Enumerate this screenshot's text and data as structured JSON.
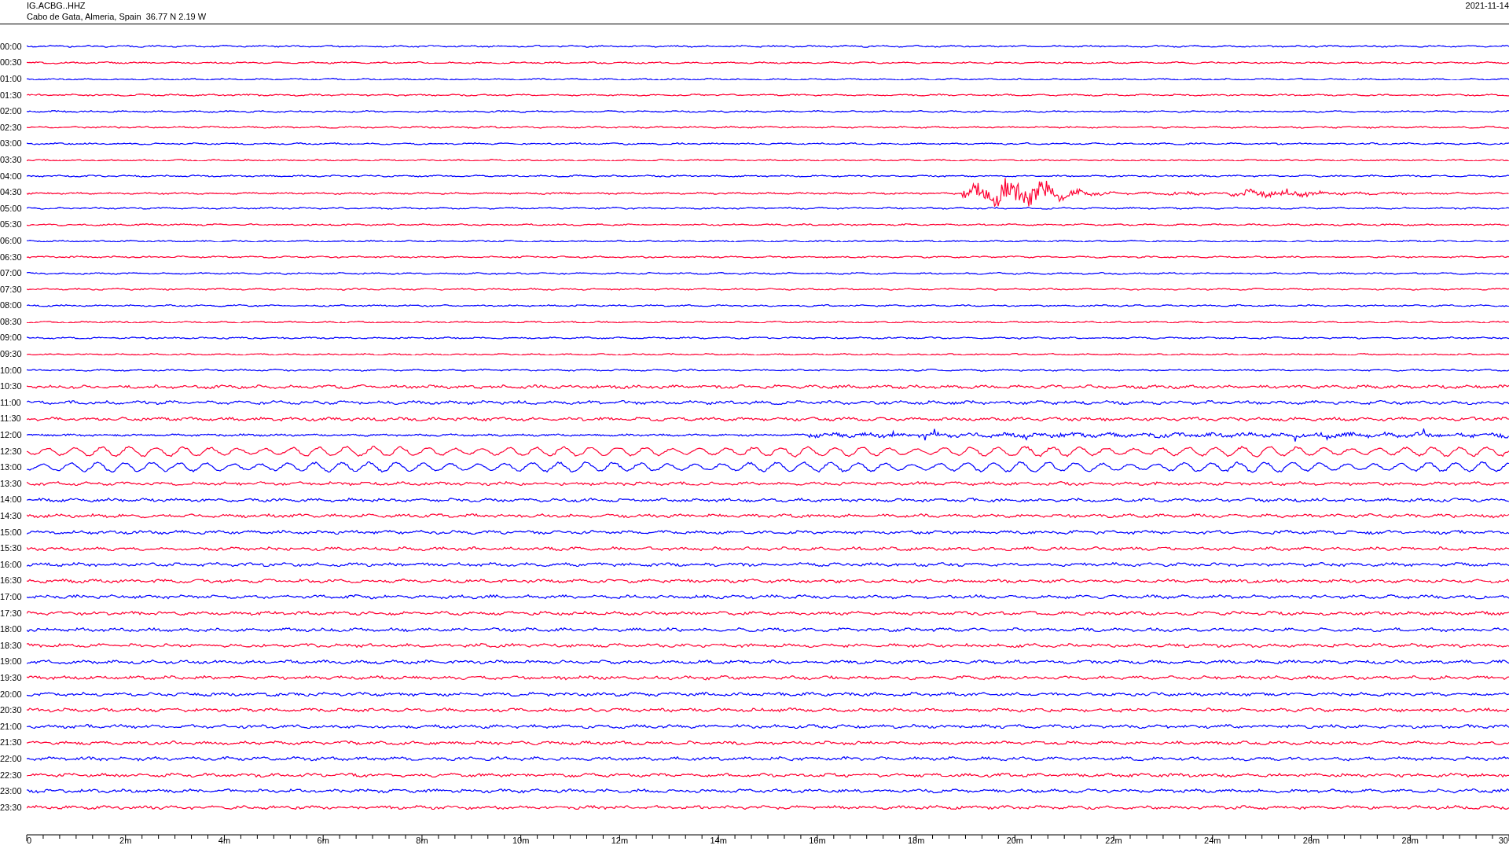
{
  "header": {
    "station": "IG.ACBG..HHZ",
    "location": "Cabo de Gata, Almeria, Spain  36.77 N 2.19 W",
    "date": "2021-11-14"
  },
  "traces": [
    {
      "time": "00:00",
      "color": "#0000ff",
      "kind": "quiet"
    },
    {
      "time": "00:30",
      "color": "#ff0033",
      "kind": "quiet"
    },
    {
      "time": "01:00",
      "color": "#0000ff",
      "kind": "quiet"
    },
    {
      "time": "01:30",
      "color": "#ff0033",
      "kind": "quiet"
    },
    {
      "time": "02:00",
      "color": "#0000ff",
      "kind": "quiet"
    },
    {
      "time": "02:30",
      "color": "#ff0033",
      "kind": "quiet"
    },
    {
      "time": "03:00",
      "color": "#0000ff",
      "kind": "quiet"
    },
    {
      "time": "03:30",
      "color": "#ff0033",
      "kind": "quiet"
    },
    {
      "time": "04:00",
      "color": "#0000ff",
      "kind": "quiet"
    },
    {
      "time": "04:30",
      "color": "#ff0033",
      "kind": "event"
    },
    {
      "time": "05:00",
      "color": "#0000ff",
      "kind": "quiet"
    },
    {
      "time": "05:30",
      "color": "#ff0033",
      "kind": "quiet"
    },
    {
      "time": "06:00",
      "color": "#0000ff",
      "kind": "quiet"
    },
    {
      "time": "06:30",
      "color": "#ff0033",
      "kind": "quiet"
    },
    {
      "time": "07:00",
      "color": "#0000ff",
      "kind": "quiet"
    },
    {
      "time": "07:30",
      "color": "#ff0033",
      "kind": "quiet"
    },
    {
      "time": "08:00",
      "color": "#0000ff",
      "kind": "quiet"
    },
    {
      "time": "08:30",
      "color": "#ff0033",
      "kind": "quiet"
    },
    {
      "time": "09:00",
      "color": "#0000ff",
      "kind": "quiet"
    },
    {
      "time": "09:30",
      "color": "#ff0033",
      "kind": "quiet"
    },
    {
      "time": "10:00",
      "color": "#0000ff",
      "kind": "quiet"
    },
    {
      "time": "10:30",
      "color": "#ff0033",
      "kind": "noisy"
    },
    {
      "time": "11:00",
      "color": "#0000ff",
      "kind": "noisy"
    },
    {
      "time": "11:30",
      "color": "#ff0033",
      "kind": "noisy"
    },
    {
      "time": "12:00",
      "color": "#0000ff",
      "kind": "burst"
    },
    {
      "time": "12:30",
      "color": "#ff0033",
      "kind": "swell"
    },
    {
      "time": "13:00",
      "color": "#0000ff",
      "kind": "swell"
    },
    {
      "time": "13:30",
      "color": "#ff0033",
      "kind": "noisy"
    },
    {
      "time": "14:00",
      "color": "#0000ff",
      "kind": "noisy"
    },
    {
      "time": "14:30",
      "color": "#ff0033",
      "kind": "noisy"
    },
    {
      "time": "15:00",
      "color": "#0000ff",
      "kind": "noisy"
    },
    {
      "time": "15:30",
      "color": "#ff0033",
      "kind": "noisy"
    },
    {
      "time": "16:00",
      "color": "#0000ff",
      "kind": "noisy"
    },
    {
      "time": "16:30",
      "color": "#ff0033",
      "kind": "noisy"
    },
    {
      "time": "17:00",
      "color": "#0000ff",
      "kind": "noisy"
    },
    {
      "time": "17:30",
      "color": "#ff0033",
      "kind": "noisy"
    },
    {
      "time": "18:00",
      "color": "#0000ff",
      "kind": "noisy"
    },
    {
      "time": "18:30",
      "color": "#ff0033",
      "kind": "noisy"
    },
    {
      "time": "19:00",
      "color": "#0000ff",
      "kind": "noisy"
    },
    {
      "time": "19:30",
      "color": "#ff0033",
      "kind": "noisy"
    },
    {
      "time": "20:00",
      "color": "#0000ff",
      "kind": "noisy"
    },
    {
      "time": "20:30",
      "color": "#ff0033",
      "kind": "noisy"
    },
    {
      "time": "21:00",
      "color": "#0000ff",
      "kind": "noisy"
    },
    {
      "time": "21:30",
      "color": "#ff0033",
      "kind": "noisy"
    },
    {
      "time": "22:00",
      "color": "#0000ff",
      "kind": "noisy"
    },
    {
      "time": "22:30",
      "color": "#ff0033",
      "kind": "noisy"
    },
    {
      "time": "23:00",
      "color": "#0000ff",
      "kind": "noisy"
    },
    {
      "time": "23:30",
      "color": "#ff0033",
      "kind": "noisy"
    }
  ],
  "x_axis": {
    "ticks": [
      "0",
      "2m",
      "4m",
      "6m",
      "8m",
      "10m",
      "12m",
      "14m",
      "16m",
      "18m",
      "20m",
      "22m",
      "24m",
      "26m",
      "28m",
      "30"
    ]
  }
}
